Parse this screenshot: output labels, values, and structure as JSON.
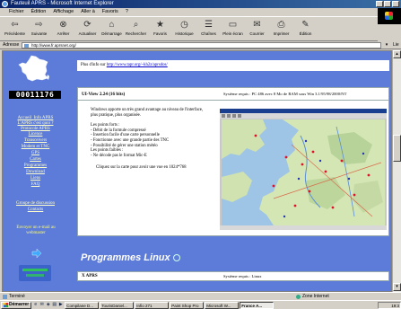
{
  "window": {
    "title": "Fauteuil APRS - Microsoft Internet Explorer"
  },
  "menu": [
    "Fichier",
    "Édition",
    "Affichage",
    "Aller à",
    "Favoris",
    "?"
  ],
  "toolbar": [
    {
      "label": "Précédente",
      "icon": "back-arrow-icon",
      "glyph": "⇦"
    },
    {
      "label": "Suivante",
      "icon": "forward-arrow-icon",
      "glyph": "⇨"
    },
    {
      "label": "Arrêter",
      "icon": "stop-icon",
      "glyph": "⊗"
    },
    {
      "label": "Actualiser",
      "icon": "refresh-icon",
      "glyph": "⟳"
    },
    {
      "label": "Démarrage",
      "icon": "home-icon",
      "glyph": "⌂"
    },
    {
      "label": "Rechercher",
      "icon": "search-icon",
      "glyph": "⌕"
    },
    {
      "label": "Favoris",
      "icon": "favorites-icon",
      "glyph": "★"
    },
    {
      "label": "Historique",
      "icon": "history-icon",
      "glyph": "◷"
    },
    {
      "label": "Chaînes",
      "icon": "channels-icon",
      "glyph": "☰"
    },
    {
      "label": "Plein écran",
      "icon": "fullscreen-icon",
      "glyph": "▭"
    },
    {
      "label": "Courrier",
      "icon": "mail-icon",
      "glyph": "✉"
    },
    {
      "label": "Imprimer",
      "icon": "print-icon",
      "glyph": "⎙"
    },
    {
      "label": "Édition",
      "icon": "edit-icon",
      "glyph": "✎"
    }
  ],
  "address": {
    "label": "Adresse",
    "url": "http://www.fr.aprsnet.org/",
    "links_label": "Lie"
  },
  "sidebar": {
    "counter": "00011176",
    "nav": [
      {
        "label": "Accueil",
        "extra": "Info APRS"
      },
      {
        "label": "L'APRS c'est quoi ?"
      },
      {
        "label": "Protocole APRS"
      },
      {
        "label": "Licence"
      },
      {
        "label": "Transceivers"
      },
      {
        "label": "Modem et TNC"
      },
      {
        "label": "GPS"
      },
      {
        "label": "Cartes"
      },
      {
        "label": "Programmes"
      },
      {
        "label": "Download"
      },
      {
        "label": "Liens"
      },
      {
        "label": "FAQ"
      },
      {
        "label": "Groupe de discussion"
      },
      {
        "label": "Contacts"
      }
    ],
    "email": "Envoyer un e-mail au webmaster"
  },
  "main": {
    "more_info": {
      "text": "Plus d'info sur",
      "link": "http://www.tapr.org/~kh2z/aprsdos/"
    },
    "uiview": {
      "title": "UI-View 2.24 (16 bits)",
      "sys": "Système requis : PC 486 avec 8 Mo de RAM sous Win 3.1/95/98/2000/NT",
      "intro": "Windows apporte un très grand avantage au niveau de l'interface, plus pratique, plus organisée.",
      "features_title": "Les points forts :",
      "features": [
        "- Débit de la formule compressé",
        "- Insertion facile d'une carte personnelle",
        "- Fonctionne avec une grande partie des TNC",
        "- Possibilité de gérer une station météo"
      ],
      "weak_title": "Les points faibles :",
      "weak": [
        "- Ne décode pas le format Mic-E"
      ],
      "click_hint": "Cliquez sur la carte pour avoir une vue en 1024*768"
    },
    "linux_title": "Programmes Linux",
    "xaprs": {
      "title": "X APRS",
      "sys": "Système requis : Linux"
    }
  },
  "status": {
    "left": "Terminé",
    "zone": "Zone Internet"
  },
  "taskbar": {
    "start": "Démarrer",
    "quicklaunch": [
      "e",
      "✉",
      "◈",
      "▤",
      "▶"
    ],
    "tasks": [
      {
        "label": "Compilane D...",
        "active": false
      },
      {
        "label": "TourisDaniel...",
        "active": false
      },
      {
        "label": "Infio 271",
        "active": false
      },
      {
        "label": "Paint Shop Pro",
        "active": false
      },
      {
        "label": "Microsoft W...",
        "active": false
      },
      {
        "label": "France A...",
        "active": true
      }
    ],
    "clock": "19:3"
  },
  "colors": {
    "page_bg": "#5d7bd8",
    "title_bar": "#0a246a",
    "link": "#0000cc",
    "nav_text": "#ffffcc",
    "email_text": "#ffff66"
  }
}
